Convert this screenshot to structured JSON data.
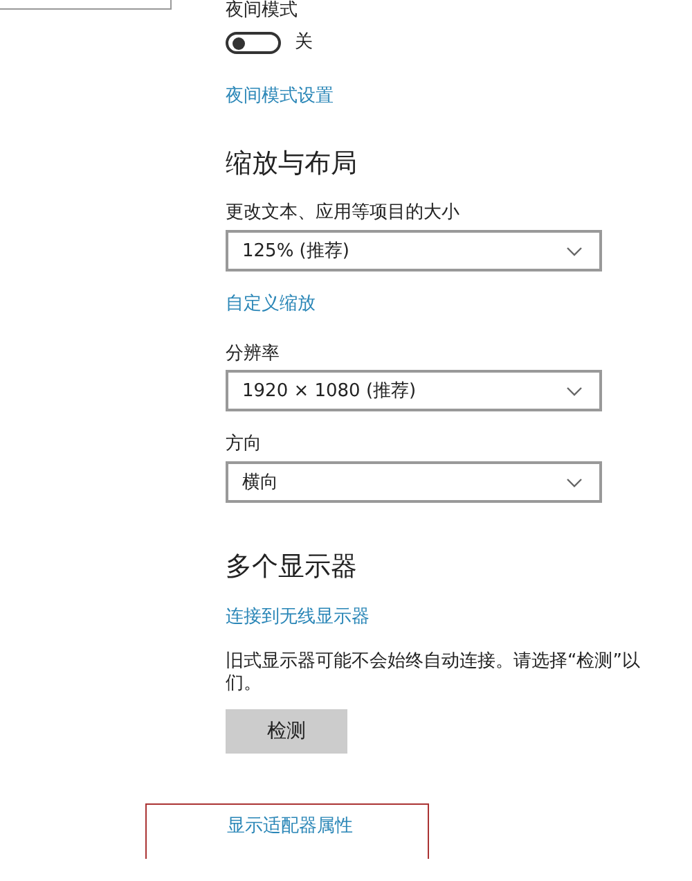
{
  "night_mode": {
    "title": "夜间模式",
    "toggle": {
      "on": false,
      "label": "关"
    },
    "settings_link": "夜间模式设置"
  },
  "scale_layout": {
    "heading": "缩放与布局",
    "fields": [
      {
        "label": "更改文本、应用等项目的大小",
        "value": "125% (推荐)",
        "link": "自定义缩放"
      },
      {
        "label": "分辨率",
        "value": "1920 × 1080 (推荐)"
      },
      {
        "label": "方向",
        "value": "横向"
      }
    ]
  },
  "multiple_displays": {
    "heading": "多个显示器",
    "link": "连接到无线显示器",
    "note_lines": [
      "旧式显示器可能不会始终自动连接。请选择“检测”以",
      "们。"
    ],
    "detect_button": "检测",
    "adapter_link": {
      "label": "显示适配器属性",
      "highlighted": true
    }
  }
}
